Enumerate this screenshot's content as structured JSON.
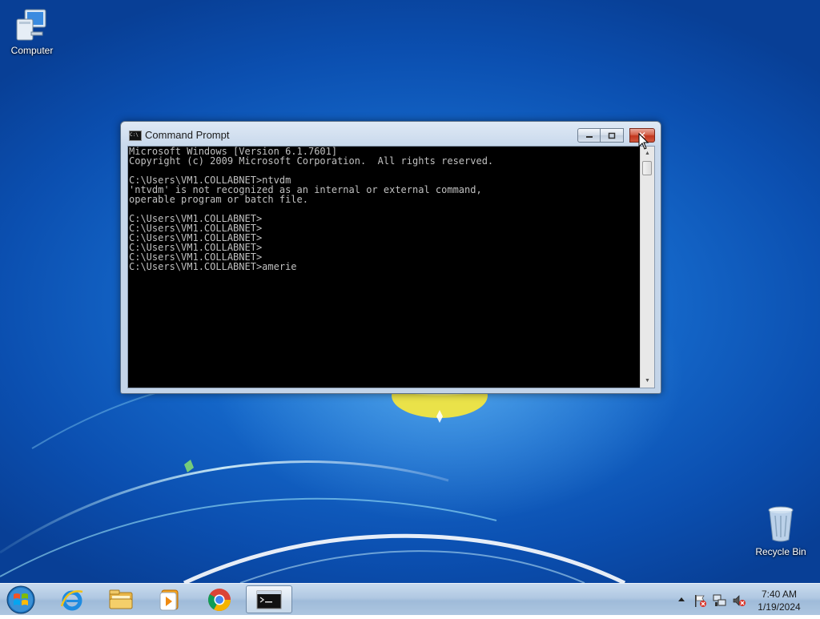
{
  "desktop": {
    "icons": [
      {
        "label": "Computer"
      },
      {
        "label": "Recycle Bin"
      }
    ]
  },
  "cmd_window": {
    "title": "Command Prompt",
    "close_symbol": "✕",
    "output_lines": [
      "Microsoft Windows [Version 6.1.7601]",
      "Copyright (c) 2009 Microsoft Corporation.  All rights reserved.",
      "",
      "C:\\Users\\VM1.COLLABNET>ntvdm",
      "'ntvdm' is not recognized as an internal or external command,",
      "operable program or batch file.",
      "",
      "C:\\Users\\VM1.COLLABNET>",
      "C:\\Users\\VM1.COLLABNET>",
      "C:\\Users\\VM1.COLLABNET>",
      "C:\\Users\\VM1.COLLABNET>",
      "C:\\Users\\VM1.COLLABNET>",
      "C:\\Users\\VM1.COLLABNET>amerie"
    ],
    "icons": {
      "title": "cmd-icon",
      "minimize": "minimize-icon",
      "maximize": "maximize-icon",
      "close": "close-icon"
    }
  },
  "taskbar": {
    "pinned": [
      {
        "icon": "start-orb-icon"
      },
      {
        "icon": "internet-explorer-icon"
      },
      {
        "icon": "file-explorer-icon"
      },
      {
        "icon": "media-player-icon"
      },
      {
        "icon": "chrome-icon"
      },
      {
        "icon": "cmd-icon"
      }
    ],
    "tray": [
      {
        "icon": "show-hidden-icons-icon"
      },
      {
        "icon": "action-center-flag-icon"
      },
      {
        "icon": "network-icon"
      },
      {
        "icon": "volume-muted-icon"
      }
    ],
    "clock": {
      "time": "7:40 AM",
      "date": "1/19/2024"
    }
  },
  "colors": {
    "console_text": "#c0c0c0",
    "console_bg": "#000000",
    "close_button": "#c7432b"
  }
}
